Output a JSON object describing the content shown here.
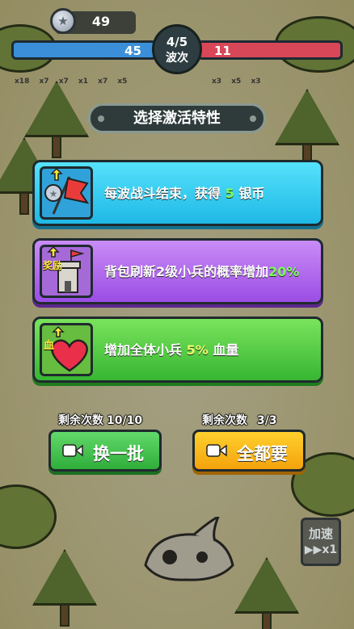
{
  "hud": {
    "silver_count": "49",
    "coin_icon": "star-coin-icon",
    "player_hp": "45",
    "enemy_hp": "11",
    "wave_progress": "4/5",
    "wave_label": "波次",
    "player_units": [
      "x18",
      "x7",
      "x7",
      "x1",
      "x7",
      "x5"
    ],
    "enemy_units": [
      "x3",
      "x5",
      "x3"
    ]
  },
  "panel": {
    "title": "选择激活特性",
    "options": [
      {
        "icon": "red-flag-coin-icon",
        "text_before": "每波战斗结束，获得",
        "highlight": "5",
        "text_after": "银币",
        "color": "#2bc5f0"
      },
      {
        "icon": "reward-tower-icon",
        "badge": "奖励",
        "text_before": "背包刷新2级小兵的概率增加",
        "highlight": "20%",
        "text_after": "",
        "color": "#a45ae8"
      },
      {
        "icon": "blood-heart-icon",
        "badge": "血",
        "text_before": "增加全体小兵",
        "highlight": "5%",
        "text_after": "血量",
        "color": "#4cc83e"
      }
    ]
  },
  "actions": {
    "refresh": {
      "count_label": "剩余次数",
      "count_value": "10/10",
      "label": "换一批",
      "icon": "video-camera-icon"
    },
    "take_all": {
      "count_label": "剩余次数",
      "count_value": "3/3",
      "label": "全都要",
      "icon": "video-camera-icon"
    }
  },
  "speed": {
    "label": "加速",
    "value": "x1",
    "icon": "fast-forward-icon"
  }
}
